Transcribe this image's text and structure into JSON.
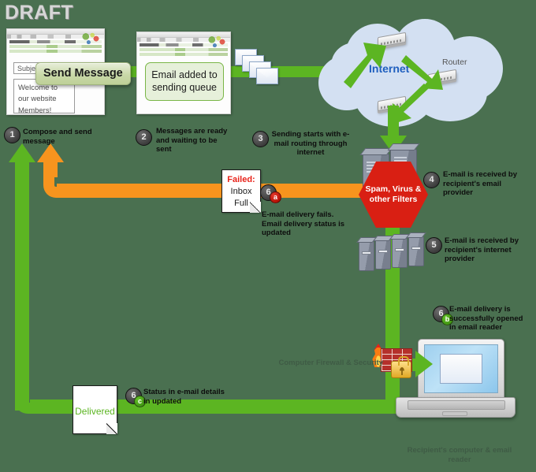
{
  "watermark": "DRAFT",
  "colors": {
    "background": "#4a7050",
    "flow_green": "#5cb522",
    "fail_orange": "#f7941e",
    "filter_red": "#d91f13",
    "internet_blue": "#1f5fbf",
    "cloud_fill": "#d3e0f2"
  },
  "windows": {
    "compose": {
      "subject_label": "Subject",
      "body_text": "Welcome to our website Members!",
      "send_button": "Send Message"
    },
    "queue": {
      "note": "Email added to sending queue"
    }
  },
  "cloud": {
    "label": "Internet",
    "router_label": "Router",
    "router_count": 3
  },
  "envelopes": {
    "queue_stack_count": 4,
    "in_cloud_count": 1
  },
  "filters": {
    "hexagon_label": "Spam, Virus & other Filters"
  },
  "documents": {
    "failed": {
      "line1": "Failed:",
      "line2": "Inbox",
      "line3": "Full"
    },
    "delivered": {
      "label": "Delivered"
    }
  },
  "steps": [
    {
      "num": "1",
      "sub": "",
      "sub_kind": "",
      "text": "Compose and send message"
    },
    {
      "num": "2",
      "sub": "",
      "sub_kind": "",
      "text": "Messages are ready and waiting to be sent"
    },
    {
      "num": "3",
      "sub": "",
      "sub_kind": "",
      "text": "Sending starts with e-mail routing through internet"
    },
    {
      "num": "4",
      "sub": "",
      "sub_kind": "",
      "text": "E-mail is received by recipient's email provider"
    },
    {
      "num": "5",
      "sub": "",
      "sub_kind": "",
      "text": "E-mail is received by recipient's internet provider"
    },
    {
      "num": "6",
      "sub": "a",
      "sub_kind": "red",
      "text": "E-mail delivery fails. Email delivery status  is updated"
    },
    {
      "num": "6",
      "sub": "b",
      "sub_kind": "green",
      "text": "E-mail delivery is successfully opened in email reader"
    },
    {
      "num": "6",
      "sub": "c",
      "sub_kind": "green",
      "text": "Status in e-mail details in updated"
    }
  ],
  "annotations": {
    "firewall": "Computer Firewall & Security",
    "recipient_device": "Recipient's computer & email reader"
  }
}
